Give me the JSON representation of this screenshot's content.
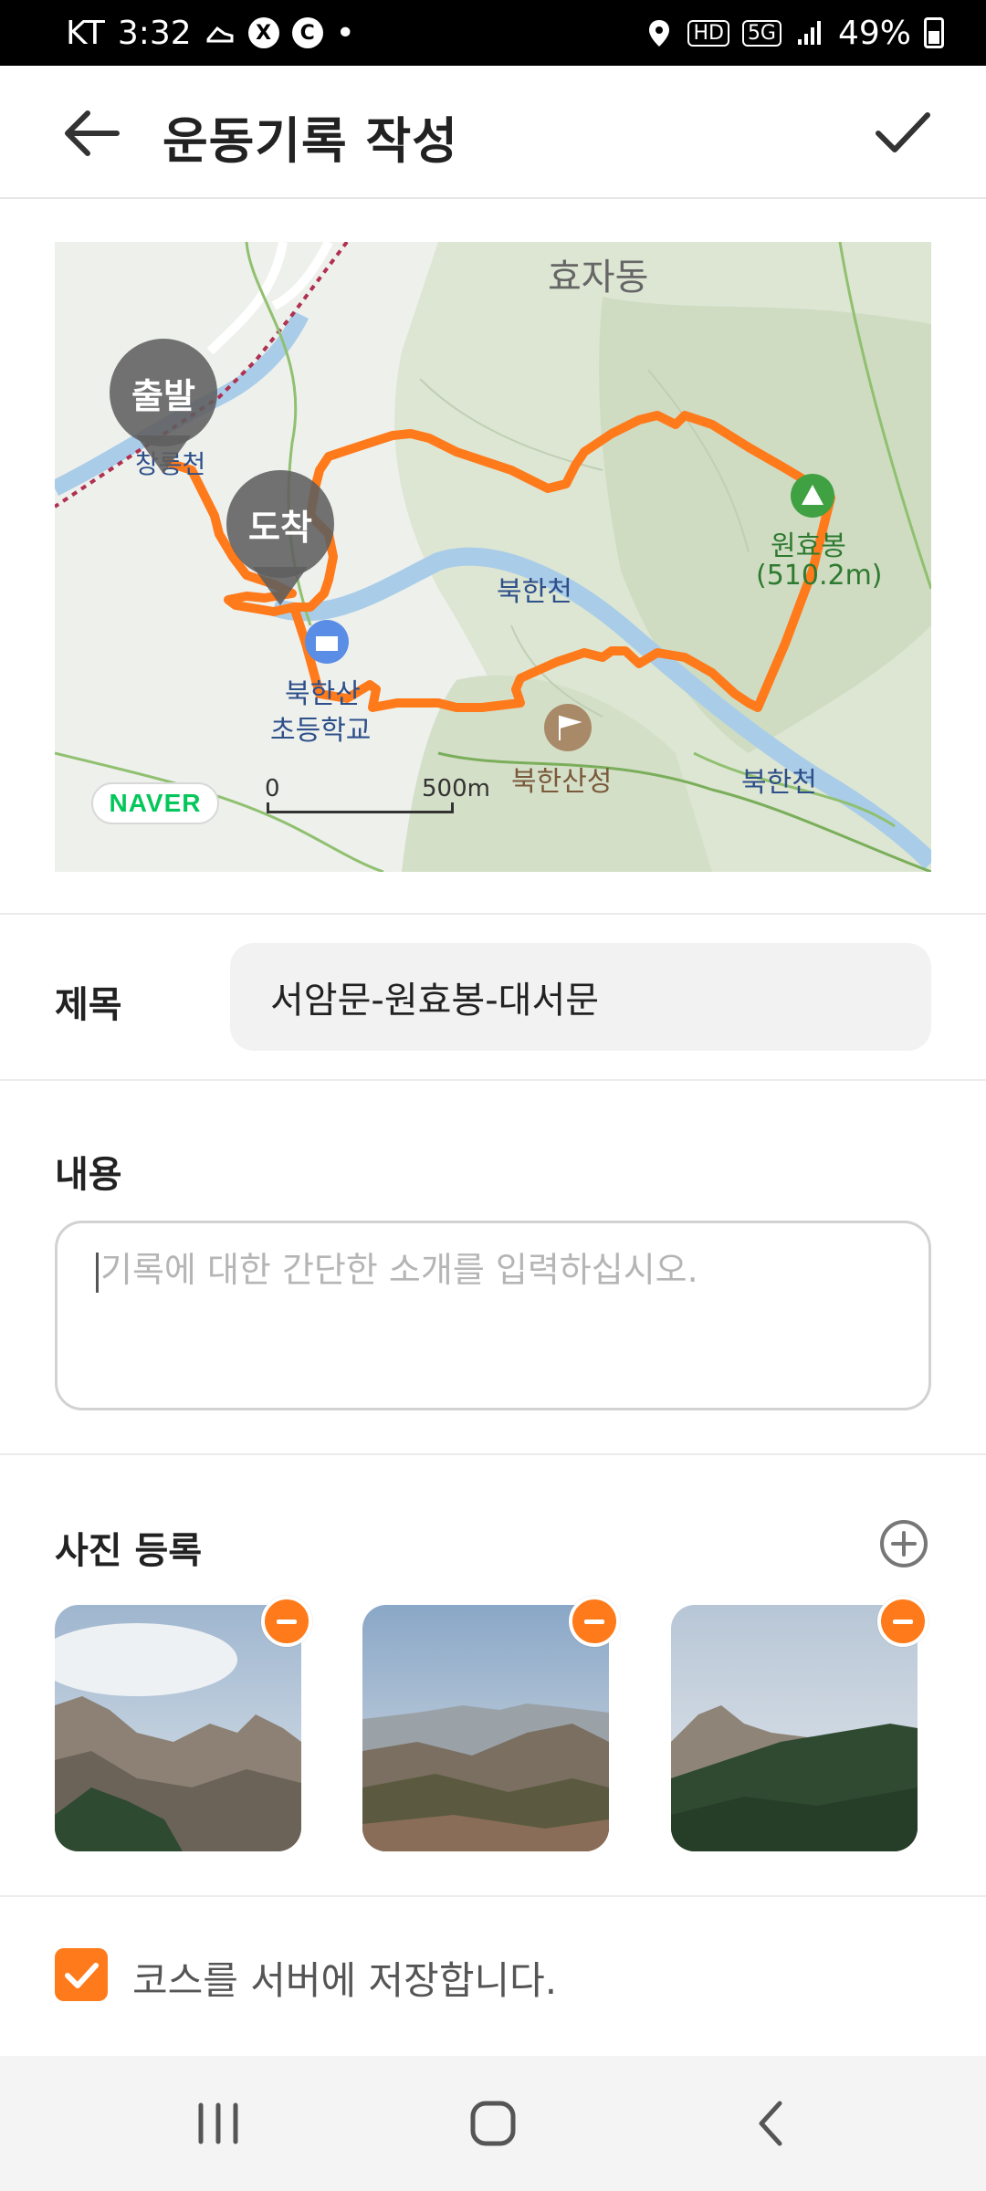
{
  "status_bar": {
    "carrier": "KT",
    "time": "3:32",
    "dot": "•",
    "icon_x": "X",
    "icon_c": "C",
    "hd": "HD",
    "network": "5G",
    "battery": "49%"
  },
  "header": {
    "title": "운동기록 작성"
  },
  "map": {
    "labels": {
      "district": "효자동",
      "river_main": "북한천",
      "river_right": "북한천",
      "peak_name": "원효봉",
      "peak_height": "(510.2m)",
      "school_line1": "북한산",
      "school_line2": "초등학교",
      "fortress": "북한산성",
      "stream": "창릉천"
    },
    "start_pin": "출발",
    "end_pin": "도착",
    "logo": "NAVER",
    "scale_zero": "0",
    "scale_distance": "500m",
    "route_color": "#ff7a1a"
  },
  "form": {
    "title_label": "제목",
    "title_value": "서암문-원효봉-대서문",
    "content_label": "내용",
    "content_placeholder": "기록에 대한 간단한 소개를 입력하십시오.",
    "photos_label": "사진 등록",
    "photos": [
      {
        "name": "photo-1"
      },
      {
        "name": "photo-2"
      },
      {
        "name": "photo-3"
      }
    ],
    "save_course_label": "코스를 서버에 저장합니다.",
    "save_course_checked": true
  },
  "colors": {
    "accent": "#ff7a1a"
  }
}
